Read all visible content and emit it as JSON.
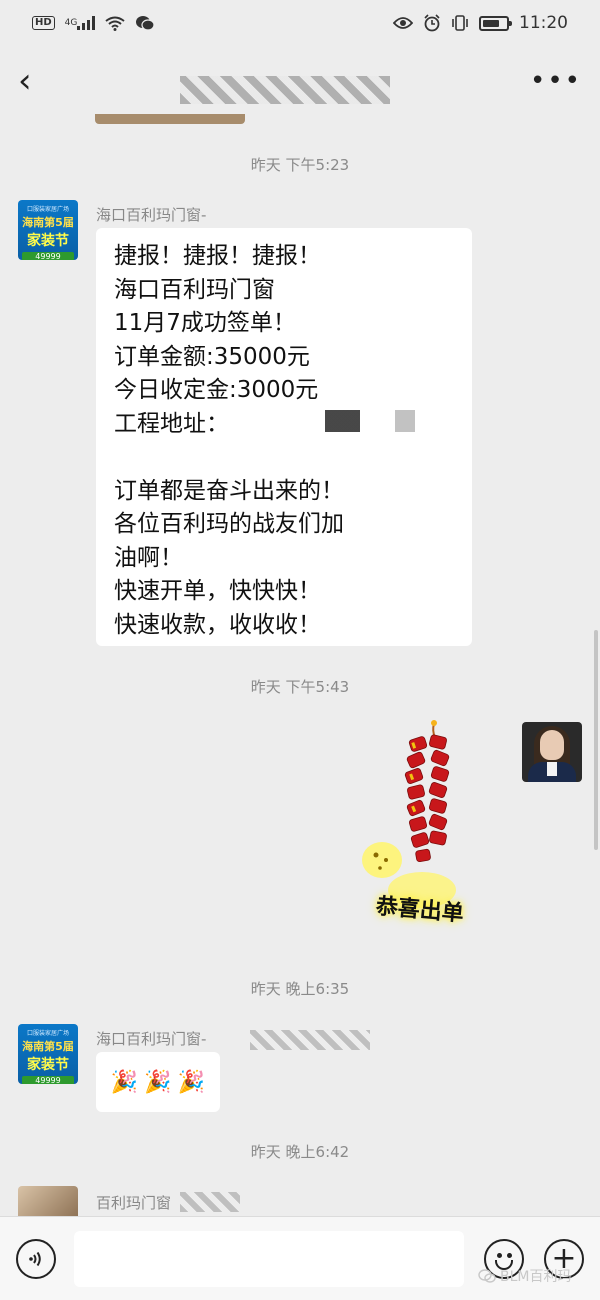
{
  "status_bar": {
    "hd": "HD",
    "network": "4G",
    "time": "11:20"
  },
  "chat": {
    "messages": [
      {
        "timestamp": "昨天 下午5:23",
        "sender": "海口百利玛门窗-",
        "text": "捷报！捷报！捷报！\n海口百利玛门窗\n11月7成功签单！\n订单金额:35000元\n今日收定金:3000元\n工程地址：\n\n订单都是奋斗出来的！\n各位百利玛的战友们加\n油啊！\n快速开单，快快快！\n快速收款，收收收！"
      },
      {
        "timestamp": "昨天 下午5:43",
        "sticker_caption": "恭喜出单"
      },
      {
        "timestamp": "昨天 晚上6:35",
        "sender": "海口百利玛门窗-",
        "reactions": [
          "🎉",
          "🎉",
          "🎉"
        ]
      },
      {
        "timestamp": "昨天 晚上6:42",
        "sender": "百利玛门窗"
      }
    ]
  },
  "avatar_brand": {
    "line1": "口服装家居广场",
    "line2": "海南第5届",
    "line3": "家装节",
    "line4": "49999"
  },
  "watermark": "BLM百利玛",
  "colors": {
    "background": "#ededed",
    "bubble": "#ffffff",
    "brand_blue": "#0b78c8"
  }
}
